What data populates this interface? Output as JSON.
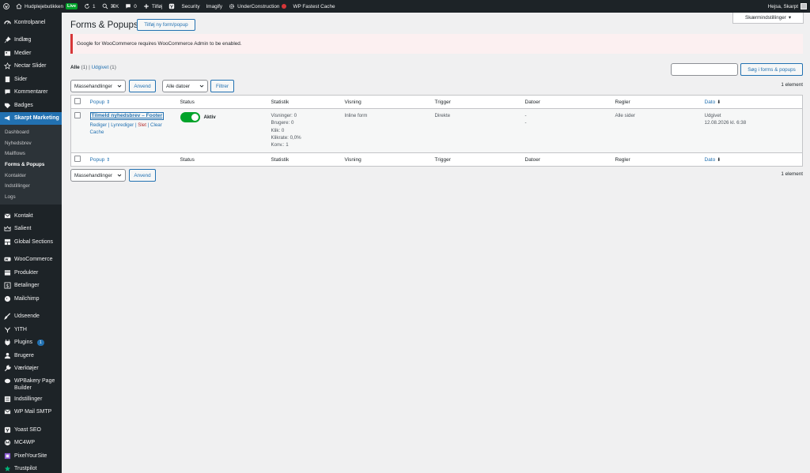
{
  "colors": {
    "accent": "#2271b1",
    "sidebar_bg": "#1d2327",
    "active_menu": "#2271b1",
    "toggle_on": "#00a32a",
    "error": "#d63638"
  },
  "adminbar": {
    "site": "Hudplejebutikken",
    "live": "Live",
    "updates": "1",
    "search": "⌘K",
    "comments": "0",
    "new": "Tilføj",
    "security": "Security",
    "imagify": "Imagify",
    "underconstruction": "UnderConstruction",
    "cache": "WP Fastest Cache",
    "greeting": "Hejsa, Skarpt"
  },
  "sidebar": {
    "dashboard": "Kontrolpanel",
    "posts": "Indlæg",
    "media": "Medier",
    "nectar": "Nectar Slider",
    "pages": "Sider",
    "comments": "Kommentarer",
    "badges": "Badges",
    "skarpt": "Skarpt Marketing",
    "sub": {
      "s1": "Dashboard",
      "s2": "Nyhedsbrev",
      "s3": "Mailflows",
      "s4": "Forms & Popups",
      "s5": "Kontakter",
      "s6": "Indstillinger",
      "s7": "Logs"
    },
    "kontakt": "Kontakt",
    "salient": "Salient",
    "global": "Global Sections",
    "woo": "WooCommerce",
    "products": "Produkter",
    "payments": "Betalinger",
    "mailchimp": "Mailchimp",
    "appearance": "Udseende",
    "yith": "YITH",
    "plugins": "Plugins",
    "plugins_count": "1",
    "users": "Brugere",
    "tools": "Værktøjer",
    "wpbakery": "WPBakery Page Builder",
    "settings": "Indstillinger",
    "smtp": "WP Mail SMTP",
    "yoast": "Yoast SEO",
    "mc4wp": "MC4WP",
    "pixel": "PixelYourSite",
    "trustpilot": "Trustpilot"
  },
  "page": {
    "title": "Forms & Popups",
    "add_new": "Tilføj ny form/popup",
    "screen_options": "Skærmindstillinger",
    "notice": "Google for WooCommerce requires WooCommerce Admin to be enabled.",
    "views": {
      "all": "Alle",
      "all_count": "(1)",
      "sep": "|",
      "published": "Udgivet",
      "published_count": "(1)"
    },
    "search_button": "Søg i forms & popups",
    "bulk": "Massehandlinger",
    "apply": "Anvend",
    "dates": "Alle datoer",
    "filter": "Filtrer",
    "items": "1 element"
  },
  "table": {
    "columns": {
      "popup": "Popup",
      "status": "Status",
      "stats": "Statistik",
      "display": "Visning",
      "trigger": "Trigger",
      "dates": "Datoer",
      "rules": "Regler",
      "date": "Dato"
    },
    "rows": [
      {
        "title": "Tilmeld nyhedsbrev – Footer",
        "edit": "Rediger",
        "quickedit": "Lynrediger",
        "delete": "Slet",
        "clear": "Clear",
        "cache": "Cache",
        "status": "Aktiv",
        "stats": [
          "Visninger: 0",
          "Brugere: 0",
          "Klik: 0",
          "Klikrate: 0,0%",
          "Konv.: 1"
        ],
        "display": "Inline form",
        "trigger": "Direkte",
        "dates": [
          "-",
          "-"
        ],
        "rules": "Alle sider",
        "date_status": "Udgivet",
        "date": "12.08.2026 kl. 6:38"
      }
    ]
  }
}
